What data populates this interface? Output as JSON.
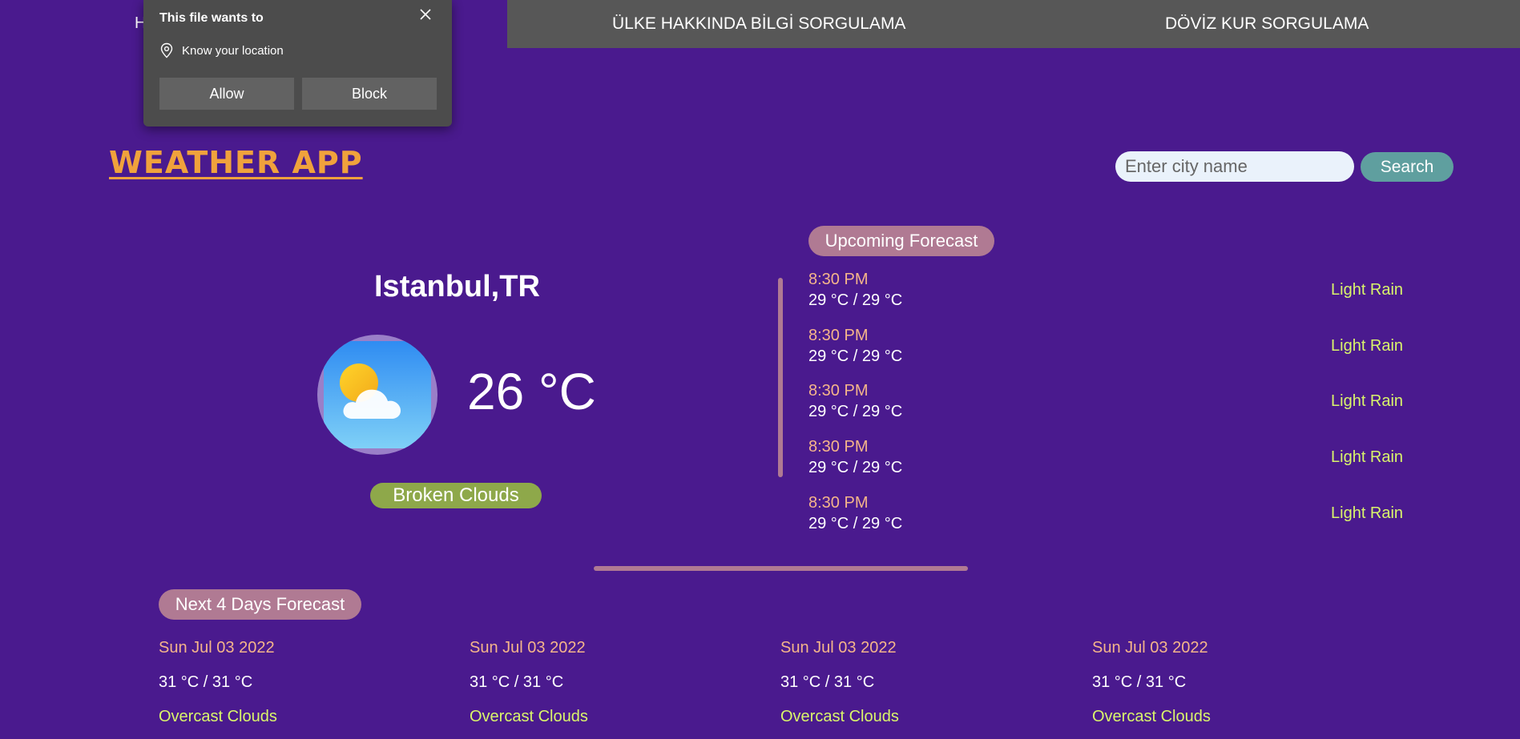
{
  "nav": {
    "home_label": "H",
    "info_label": "ÜLKE HAKKINDA BİLGİ SORGULAMA",
    "doviz_label": "DÖVİZ KUR SORGULAMA"
  },
  "popup": {
    "title": "This file wants to",
    "permission": "Know your location",
    "allow_label": "Allow",
    "block_label": "Block"
  },
  "header": {
    "app_title": "WEATHER APP",
    "search_placeholder": "Enter city name",
    "search_value": "",
    "search_button": "Search"
  },
  "current": {
    "city": "Istanbul,TR",
    "temp": "26 °C",
    "description": "Broken Clouds",
    "icon": "partly-cloudy-icon"
  },
  "upcoming": {
    "label": "Upcoming Forecast",
    "items": [
      {
        "time": "8:30 PM",
        "temp": "29 °C / 29 °C",
        "desc": "Light Rain"
      },
      {
        "time": "8:30 PM",
        "temp": "29 °C / 29 °C",
        "desc": "Light Rain"
      },
      {
        "time": "8:30 PM",
        "temp": "29 °C / 29 °C",
        "desc": "Light Rain"
      },
      {
        "time": "8:30 PM",
        "temp": "29 °C / 29 °C",
        "desc": "Light Rain"
      },
      {
        "time": "8:30 PM",
        "temp": "29 °C / 29 °C",
        "desc": "Light Rain"
      }
    ]
  },
  "next_days": {
    "label": "Next 4 Days Forecast",
    "items": [
      {
        "date": "Sun Jul 03 2022",
        "temp": "31 °C / 31 °C",
        "desc": "Overcast Clouds"
      },
      {
        "date": "Sun Jul 03 2022",
        "temp": "31 °C / 31 °C",
        "desc": "Overcast Clouds"
      },
      {
        "date": "Sun Jul 03 2022",
        "temp": "31 °C / 31 °C",
        "desc": "Overcast Clouds"
      },
      {
        "date": "Sun Jul 03 2022",
        "temp": "31 °C / 31 °C",
        "desc": "Overcast Clouds"
      }
    ]
  },
  "colors": {
    "background": "#4a1a8e",
    "title_orange": "#f0a23c",
    "badge_green": "#8ea84a",
    "pill_pink": "#b07a93",
    "search_teal": "#5f9f9f",
    "time_peach": "#f5b58a",
    "desc_lime": "#d9f56b"
  }
}
